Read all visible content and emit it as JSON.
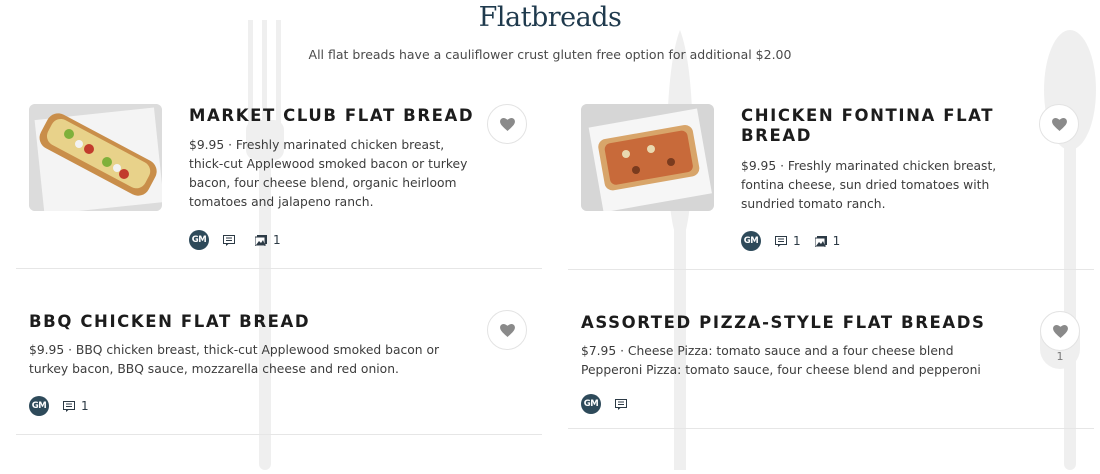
{
  "section": {
    "title": "Flatbreads",
    "subtitle": "All flat breads have a cauliflower crust gluten free option for additional $2.00"
  },
  "items": [
    {
      "name": "MARKET CLUB FLAT BREAD",
      "description": "$9.95 · Freshly marinated chicken breast, thick-cut Applewood smoked bacon or turkey bacon, four cheese blend, organic heirloom tomatoes and jalapeno ranch.",
      "badge": "GM",
      "comments": "",
      "photos": "1",
      "likes": ""
    },
    {
      "name": "CHICKEN FONTINA FLAT BREAD",
      "description": "$9.95 · Freshly marinated chicken breast, fontina cheese, sun dried tomatoes with sundried tomato ranch.",
      "badge": "GM",
      "comments": "1",
      "photos": "1",
      "likes": ""
    },
    {
      "name": "BBQ CHICKEN FLAT BREAD",
      "description": "$9.95 · BBQ chicken breast, thick-cut Applewood smoked bacon or turkey bacon, BBQ sauce, mozzarella cheese and red onion.",
      "badge": "GM",
      "comments": "1",
      "photos": "",
      "likes": ""
    },
    {
      "name": "ASSORTED PIZZA-STYLE FLAT BREADS",
      "description_line1": "$7.95 · Cheese Pizza: tomato sauce and a four cheese blend",
      "description_line2": "Pepperoni Pizza: tomato sauce, four cheese blend and pepperoni",
      "badge": "GM",
      "comments": "",
      "photos": "",
      "likes": "1"
    }
  ],
  "icons": {
    "comment": "comment-icon",
    "photo": "photo-icon",
    "heart": "heart-icon"
  },
  "colors": {
    "title": "#1f3a4d",
    "badge": "#2e4a5a"
  }
}
